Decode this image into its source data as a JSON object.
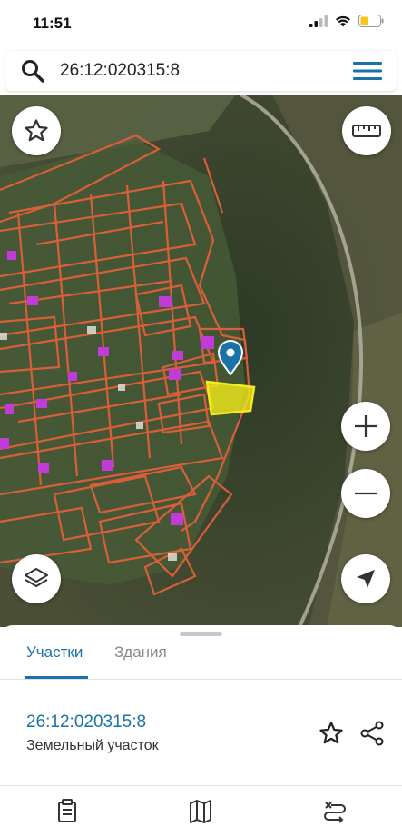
{
  "status_bar": {
    "time": "11:51"
  },
  "search": {
    "query": "26:12:020315:8"
  },
  "sheet": {
    "tabs": [
      {
        "label": "Участки",
        "active": true
      },
      {
        "label": "Здания",
        "active": false
      }
    ],
    "result": {
      "cadastral_number": "26:12:020315:8",
      "type": "Земельный участок"
    }
  },
  "colors": {
    "accent": "#1a73a8",
    "parcel_outline": "#e0603a",
    "selected_parcel": "#f2ec1a",
    "building": "#c13bd6"
  },
  "icons": {
    "search": "search-icon",
    "menu": "menu-icon",
    "favorite": "star-icon",
    "ruler": "ruler-icon",
    "zoom_in": "plus-icon",
    "zoom_out": "minus-icon",
    "layers": "layers-icon",
    "locate": "navigation-arrow-icon",
    "share": "share-icon"
  }
}
